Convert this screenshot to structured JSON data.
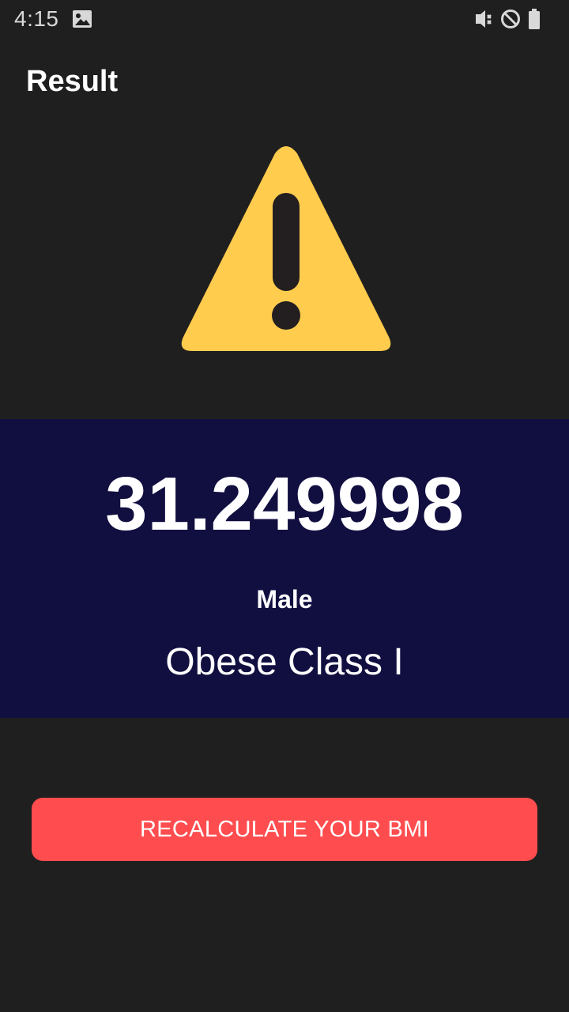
{
  "status_bar": {
    "time": "4:15",
    "icons": [
      "image-icon",
      "vibrate-off-icon",
      "do-not-disturb-icon",
      "battery-icon"
    ]
  },
  "header": {
    "title": "Result"
  },
  "warning": {
    "icon": "warning-triangle-icon",
    "color": "#ffcc4d"
  },
  "result": {
    "bmi_value": "31.249998",
    "gender": "Male",
    "category": "Obese Class I",
    "panel_color": "#110e40"
  },
  "actions": {
    "recalculate_label": "RECALCULATE YOUR BMI",
    "button_color": "#ff4d4f"
  }
}
